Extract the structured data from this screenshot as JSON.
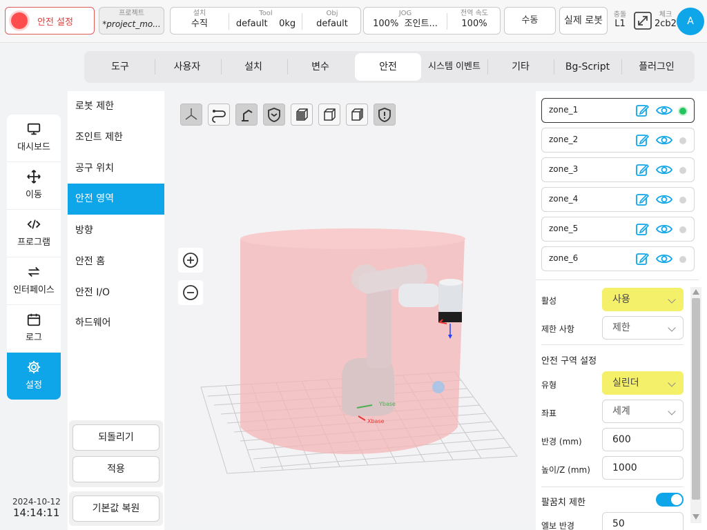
{
  "topbar": {
    "safety_label": "안전 설정",
    "project_label": "프로젝트",
    "project_value": "*project_mo...",
    "install_label": "설치",
    "install_value": "수직",
    "tool_label": "Tool",
    "tool_value": "default",
    "tool_weight": "0kg",
    "obj_label": "Obj",
    "obj_value": "default",
    "jog_label": "JOG",
    "jog_percent": "100%",
    "jog_mode": "조인트...",
    "speed_label": "전역 속도",
    "speed_value": "100%",
    "manual_label": "수동",
    "real_robot_label": "실제 로봇",
    "collision_label": "충돌",
    "collision_value": "L1",
    "check_label": "체크",
    "check_value": "2cb2",
    "avatar": "A"
  },
  "tabs": [
    "도구",
    "사용자",
    "설치",
    "변수",
    "안전",
    "시스템 이벤트",
    "기타",
    "Bg-Script",
    "플러그인"
  ],
  "active_tab": "안전",
  "leftnav": [
    {
      "label": "대시보드",
      "icon": "monitor-icon"
    },
    {
      "label": "이동",
      "icon": "move-icon"
    },
    {
      "label": "프로그램",
      "icon": "code-icon"
    },
    {
      "label": "인터페이스",
      "icon": "swap-icon"
    },
    {
      "label": "로그",
      "icon": "calendar-icon"
    },
    {
      "label": "설정",
      "icon": "gear-icon"
    }
  ],
  "submenu": [
    "로봇 제한",
    "조인트 제한",
    "공구 위치",
    "안전 영역",
    "방향",
    "안전 홈",
    "안전 I/O",
    "하드웨어"
  ],
  "buttons": {
    "undo": "되돌리기",
    "apply": "적용",
    "reset": "기본값 복원"
  },
  "datetime": {
    "date": "2024-10-12",
    "time": "14:14:11"
  },
  "zones": [
    "zone_1",
    "zone_2",
    "zone_3",
    "zone_4",
    "zone_5",
    "zone_6"
  ],
  "properties": {
    "active_label": "활성",
    "active_value": "사용",
    "restrict_label": "제한 사항",
    "restrict_value": "제한",
    "section_title": "안전 구역 설정",
    "type_label": "유형",
    "type_value": "실린더",
    "coord_label": "좌표",
    "coord_value": "세계",
    "radius_label": "반경 (mm)",
    "radius_value": "600",
    "height_label": "높이/Z (mm)",
    "height_value": "1000",
    "elbow_label": "팔꿈치 제한",
    "elbow_radius_label": "엘보 반경",
    "elbow_radius_value": "50"
  },
  "axis_labels": {
    "x": "Xbase",
    "y": "Ybase"
  },
  "colors": {
    "accent": "#0ea5e9",
    "highlight": "#f5f06a",
    "danger": "#e53935",
    "zone_fill": "#f4b5b5",
    "active_dot": "#22c55e"
  }
}
